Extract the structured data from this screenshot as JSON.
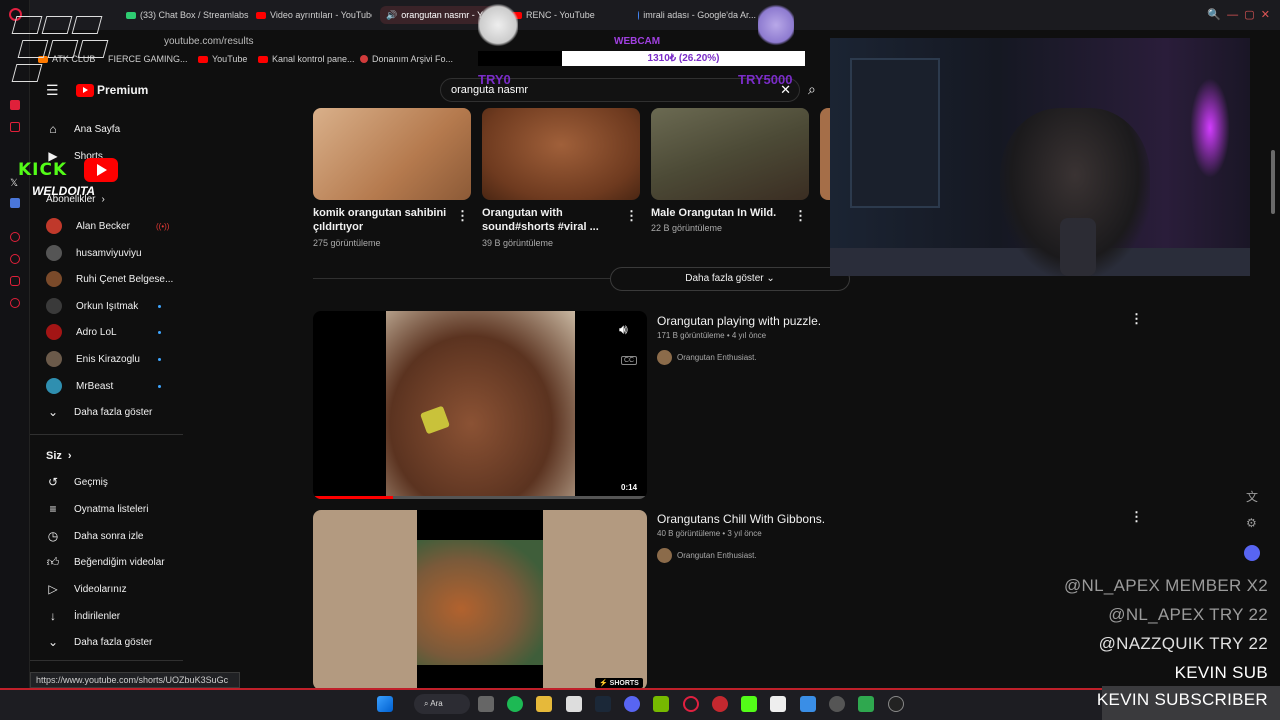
{
  "browser": {
    "tabs": [
      {
        "label": "(33) Chat Box / Streamlabs",
        "active": false
      },
      {
        "label": "Video ayrıntıları - YouTube",
        "active": false
      },
      {
        "label": "orangutan nasmr - Yo...",
        "active": true
      },
      {
        "label": "RENC - YouTube",
        "active": false
      },
      {
        "label": "imrali adası - Google'da Ar...",
        "active": false
      }
    ],
    "url": "youtube.com/results",
    "bookmarks": [
      "ATK CLUB",
      "FIERCE GAMING...",
      "YouTube",
      "Kanal kontrol pane...",
      "Donanım Arşivi Fo..."
    ],
    "status_url": "https://www.youtube.com/shorts/UOZbuK3SuGc"
  },
  "youtube": {
    "logo_label": "Premium",
    "search_value": "oranguta nasmr",
    "sidebar": {
      "main": [
        {
          "label": "Ana Sayfa",
          "icon": "home-icon"
        },
        {
          "label": "Shorts",
          "icon": "shorts-icon"
        }
      ],
      "subscriptions_header": "Abonelikler",
      "subscriptions": [
        {
          "label": "Alan Becker",
          "color": "#c0392b",
          "badge": "live"
        },
        {
          "label": "husamviyuviyu",
          "color": "#555555",
          "badge": ""
        },
        {
          "label": "Ruhi Çenet Belgese...",
          "color": "#7a4a2a",
          "badge": ""
        },
        {
          "label": "Orkun Işıtmak",
          "color": "#3a3a3a",
          "badge": "new"
        },
        {
          "label": "Adro LoL",
          "color": "#a31515",
          "badge": "new"
        },
        {
          "label": "Enis Kirazoglu",
          "color": "#6b5a4a",
          "badge": "new"
        },
        {
          "label": "MrBeast",
          "color": "#2f8fb0",
          "badge": "new"
        }
      ],
      "subs_more": "Daha fazla göster",
      "you_header": "Siz",
      "you_items": [
        {
          "label": "Geçmiş",
          "icon": "history-icon"
        },
        {
          "label": "Oynatma listeleri",
          "icon": "playlist-icon"
        },
        {
          "label": "Daha sonra izle",
          "icon": "clock-icon"
        },
        {
          "label": "Beğendiğim videolar",
          "icon": "thumbs-up-icon"
        },
        {
          "label": "Videolarınız",
          "icon": "video-icon"
        },
        {
          "label": "İndirilenler",
          "icon": "download-icon"
        },
        {
          "label": "Daha fazla göster",
          "icon": "chevron-down-icon"
        }
      ]
    },
    "shorts_row": [
      {
        "title": "komik orangutan sahibini çıldırtıyor",
        "views": "275 görüntüleme"
      },
      {
        "title": "Orangutan with sound#shorts #viral ...",
        "views": "39 B görüntüleme"
      },
      {
        "title": "Male Orangutan In Wild.",
        "views": "22 B görüntüleme"
      }
    ],
    "show_more": "Daha fazla göster",
    "results": [
      {
        "title": "Orangutan playing with puzzle.",
        "meta": "171 B görüntüleme • 4 yıl önce",
        "channel": "Orangutan Enthusiast.",
        "duration": "0:14",
        "progress": 0.24
      },
      {
        "title": "Orangutans Chill With Gibbons.",
        "meta": "40 B görüntüleme • 3 yıl önce",
        "channel": "Orangutan Enthusiast.",
        "badge": "SHORTS"
      }
    ]
  },
  "stream_overlay": {
    "webcam_label": "WEBCAM",
    "goal_text": "1310₺ (26.20%)",
    "goal_fraction": 0.262,
    "goal_min": "TRY0",
    "goal_max": "TRY5000",
    "kick_label": "KICK",
    "weldo_label": "WELDOITA",
    "events": [
      "@NL_APEX  MEMBER X2",
      "@NL_APEX  TRY 22",
      "@NAZZQUIK  TRY 22",
      "KEVIN  SUB",
      "KEVIN  SUBSCRIBER"
    ]
  },
  "taskbar": {
    "search_label": "Ara"
  }
}
